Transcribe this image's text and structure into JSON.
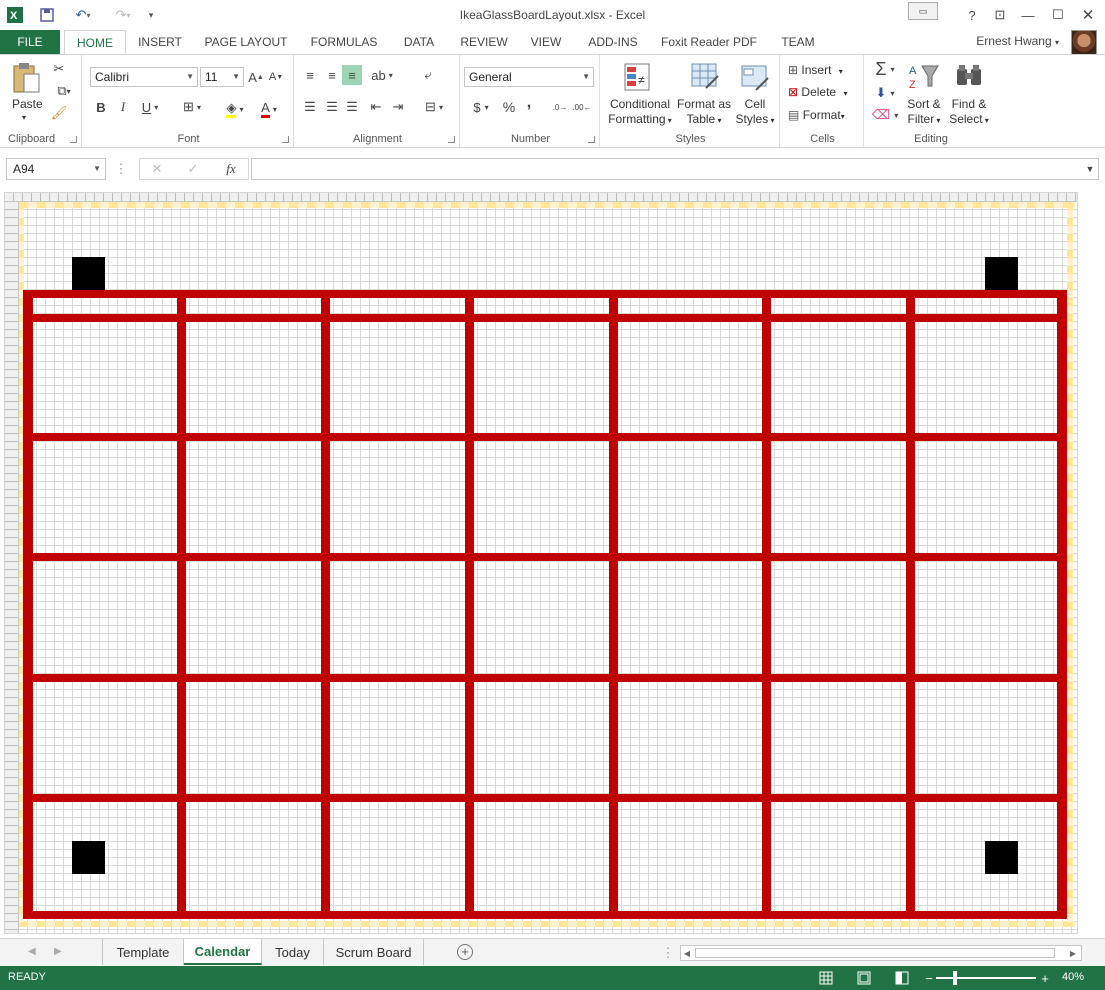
{
  "window": {
    "title": "IkeaGlassBoardLayout.xlsx - Excel",
    "help": "?"
  },
  "ribbon_tabs": [
    "FILE",
    "HOME",
    "INSERT",
    "PAGE LAYOUT",
    "FORMULAS",
    "DATA",
    "REVIEW",
    "VIEW",
    "ADD-INS",
    "Foxit Reader PDF",
    "TEAM"
  ],
  "active_tab": "HOME",
  "user": {
    "name": "Ernest Hwang"
  },
  "clipboard": {
    "paste": "Paste",
    "label": "Clipboard"
  },
  "font": {
    "name": "Calibri",
    "size": "11",
    "label": "Font",
    "bold": "B",
    "italic": "I",
    "underline": "U"
  },
  "alignment": {
    "label": "Alignment"
  },
  "number": {
    "format": "General",
    "label": "Number",
    "currency": "$",
    "percent": "%",
    "comma": ","
  },
  "styles": {
    "label": "Styles",
    "conditional_1": "Conditional",
    "conditional_2": "Formatting",
    "table_1": "Format as",
    "table_2": "Table",
    "cell_1": "Cell",
    "cell_2": "Styles"
  },
  "cells": {
    "label": "Cells",
    "insert": "Insert",
    "delete": "Delete",
    "format": "Format"
  },
  "editing": {
    "label": "Editing",
    "sort_1": "Sort &",
    "sort_2": "Filter",
    "find_1": "Find &",
    "find_2": "Select"
  },
  "formula_bar": {
    "name_box": "A94",
    "fx": "fx",
    "value": ""
  },
  "sheet_tabs": [
    "Template",
    "Calendar",
    "Today",
    "Scrum Board"
  ],
  "active_sheet": "Calendar",
  "status": {
    "text": "READY",
    "zoom": "40%"
  },
  "colors": {
    "accent": "#217346",
    "grid_line": "#c00000",
    "marker": "#000000"
  }
}
